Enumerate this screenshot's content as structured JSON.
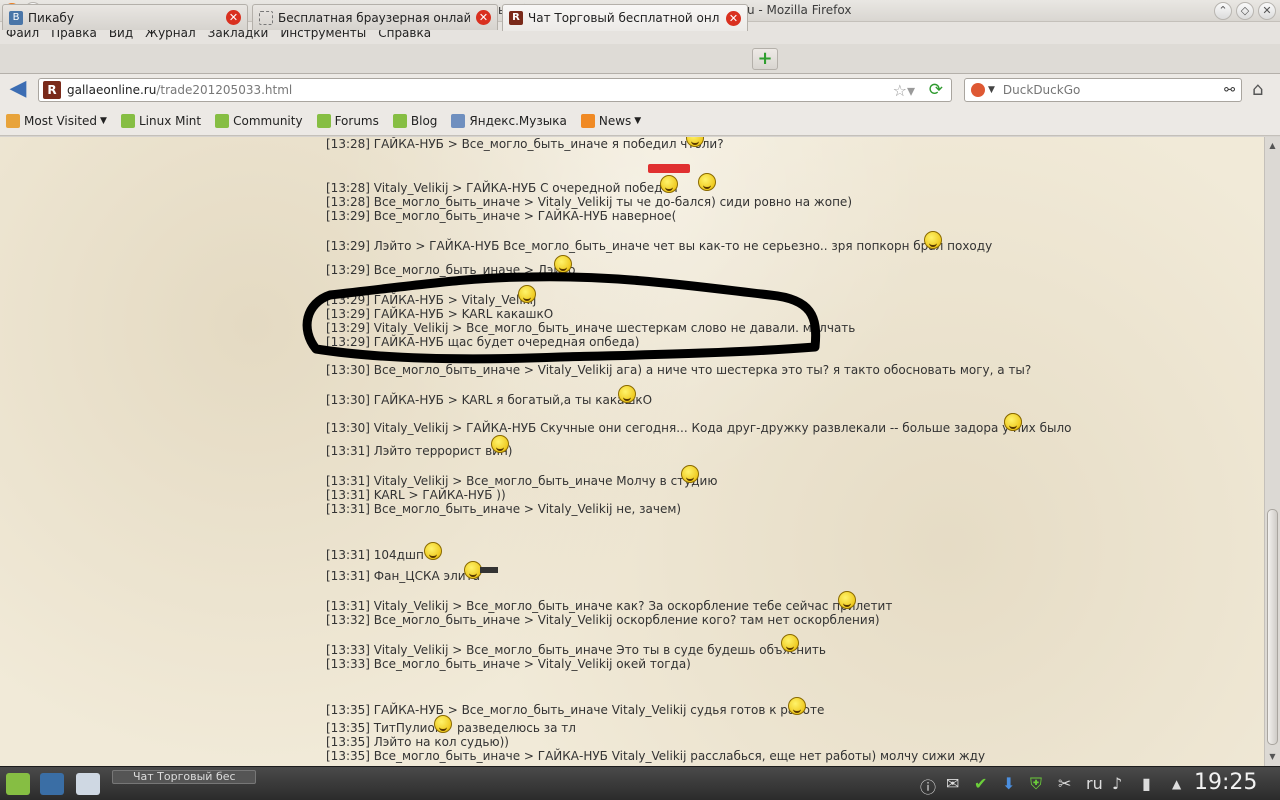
{
  "window": {
    "title": "Чат Торговый бесплатной онлайн игры RomeWar.ru - Mozilla Firefox"
  },
  "menu": [
    "Файл",
    "Правка",
    "Вид",
    "Журнал",
    "Закладки",
    "Инструменты",
    "Справка"
  ],
  "tabs": [
    {
      "label": "Пикабу",
      "active": false
    },
    {
      "label": "Бесплатная браузерная онлайн и...",
      "active": false
    },
    {
      "label": "Чат Торговый бесплатной онлай...",
      "active": true
    }
  ],
  "address": {
    "domain": "gallaeonline.ru",
    "path": "/trade201205033.html"
  },
  "search": {
    "placeholder": "DuckDuckGo"
  },
  "bookmarks": [
    "Most Visited",
    "Linux Mint",
    "Community",
    "Forums",
    "Blog",
    "Яндекс.Музыка",
    "News"
  ],
  "chat": [
    {
      "text": "[13:28] ГАЙКА-НУБ > Все_могло_быть_иначе я победил чтоли?"
    },
    {
      "text": "[13:28] Vitaly_Velikij > ГАЙКА-НУБ С очередной победой"
    },
    {
      "text": "[13:28] Все_могло_быть_иначе > Vitaly_Velikij ты че до-бался) сиди ровно на жопе)"
    },
    {
      "text": "[13:29] Все_могло_быть_иначе > ГАЙКА-НУБ наверное("
    },
    {
      "text": "[13:29] Лэйто > ГАЙКА-НУБ Все_могло_быть_иначе чет вы как-то не серьезно.. зря попкорн брал походу"
    },
    {
      "text": "[13:29] Все_могло_быть_иначе > Лэйто"
    },
    {
      "text": "[13:29] ГАЙКА-НУБ > Vitaly_Velikij"
    },
    {
      "text": "[13:29] ГАЙКА-НУБ > KARL какашкО"
    },
    {
      "text": "[13:29] Vitaly_Velikij > Все_могло_быть_иначе шестеркам слово не давали. молчать"
    },
    {
      "text": "[13:29] ГАЙКА-НУБ щас будет очередная опбеда)"
    },
    {
      "text": "[13:30] Все_могло_быть_иначе > Vitaly_Velikij ага) а ниче что шестерка это ты? я такто обосновать могу, а ты?"
    },
    {
      "text": "[13:30] ГАЙКА-НУБ > KARL я богатый,а ты какашкО"
    },
    {
      "text": "[13:30] Vitaly_Velikij > ГАЙКА-НУБ Скучные они сегодня... Кода друг-дружку развлекали -- больше задора у них было"
    },
    {
      "text": "[13:31] Лэйто террорист вин)"
    },
    {
      "text": "[13:31] Vitaly_Velikij > Все_могло_быть_иначе Молчу в студию"
    },
    {
      "text": "[13:31] KARL > ГАЙКА-НУБ ))"
    },
    {
      "text": "[13:31] Все_могло_быть_иначе > Vitaly_Velikij не, зачем)"
    },
    {
      "text": "[13:31] 104дшп"
    },
    {
      "text": "[13:31] Фан_ЦСКА элита"
    },
    {
      "text": "[13:31] Vitaly_Velikij > Все_могло_быть_иначе как? За оскорбление тебе сейчас прилетит"
    },
    {
      "text": "[13:32] Все_могло_быть_иначе > Vitaly_Velikij оскорбление кого? там нет оскорбления)"
    },
    {
      "text": "[13:33] Vitaly_Velikij > Все_могло_быть_иначе Это ты в суде будешь объяснить"
    },
    {
      "text": "[13:33] Все_могло_быть_иначе > Vitaly_Velikij окей тогда)"
    },
    {
      "text": "[13:35] ГАЙКА-НУБ > Все_могло_быть_иначе Vitaly_Velikij судья готов к работе"
    },
    {
      "text": "[13:35] ТитПулион"
    },
    {
      "text": "разведелюсь за тл"
    },
    {
      "text": "[13:35] Лэйто на кол судью))"
    },
    {
      "text": "[13:35] Все_могло_быть_иначе > ГАЙКА-НУБ Vitaly_Velikij расслабься, еще нет работы) молчу сижи жду"
    }
  ],
  "taskbar": {
    "task_label": "Чат Торговый бес",
    "keyboard_layout": "ru",
    "clock": "19:25"
  },
  "colors": {
    "annotation": "#000000",
    "page_bg": "#f1ead8",
    "taskbar": "#333333"
  }
}
